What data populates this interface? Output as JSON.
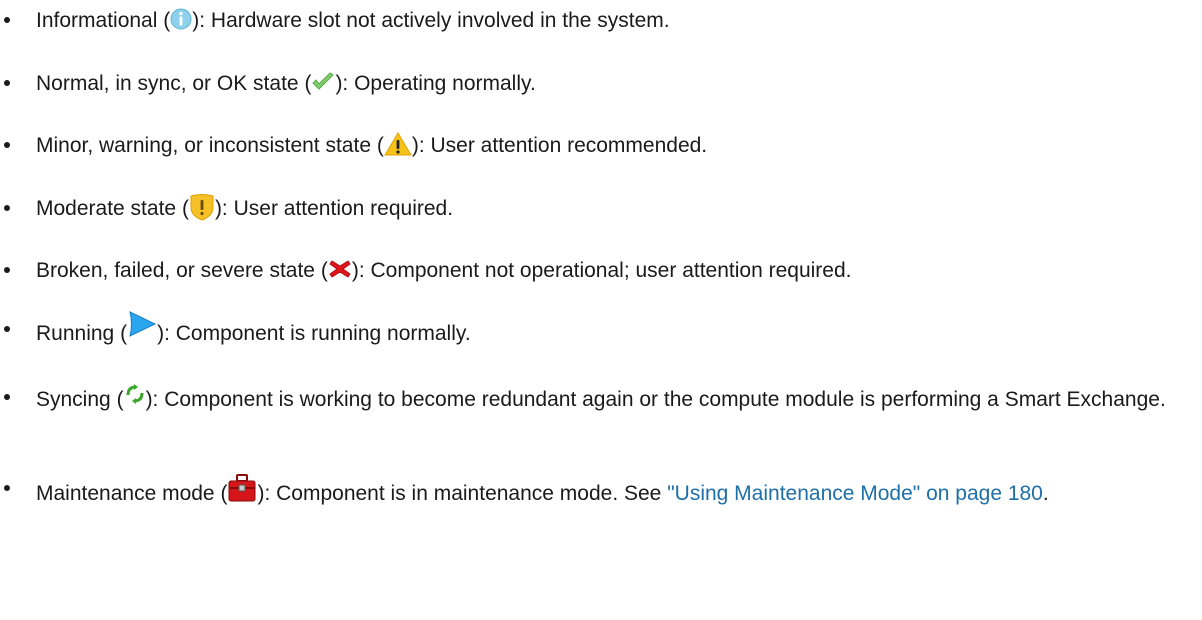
{
  "items": [
    {
      "label": "Informational",
      "icon": "info-icon",
      "desc": "): Hardware slot not actively involved in the system."
    },
    {
      "label": "Normal, in sync, or OK state",
      "icon": "checkmark-icon",
      "desc": "): Operating normally."
    },
    {
      "label": "Minor, warning, or inconsistent state",
      "icon": "warning-triangle-icon",
      "desc": "): User attention recommended."
    },
    {
      "label": "Moderate state",
      "icon": "moderate-shield-icon",
      "desc": "): User attention required."
    },
    {
      "label": "Broken, failed, or severe state",
      "icon": "red-x-icon",
      "desc": "): Component not operational; user attention required."
    },
    {
      "label": "Running",
      "icon": "play-arrow-icon",
      "desc": "): Component is running normally."
    },
    {
      "label": "Syncing",
      "icon": "sync-arrows-icon",
      "desc": "): Component is working to become redundant again or the compute module is performing a Smart Exchange."
    },
    {
      "label": "Maintenance mode",
      "icon": "toolbox-icon",
      "desc": "): Component is in maintenance mode. See ",
      "link": "\"Using Maintenance Mode\" on page 180",
      "tail": "."
    }
  ],
  "colors": {
    "text": "#1a1a1a",
    "link": "#1f6fa8"
  }
}
